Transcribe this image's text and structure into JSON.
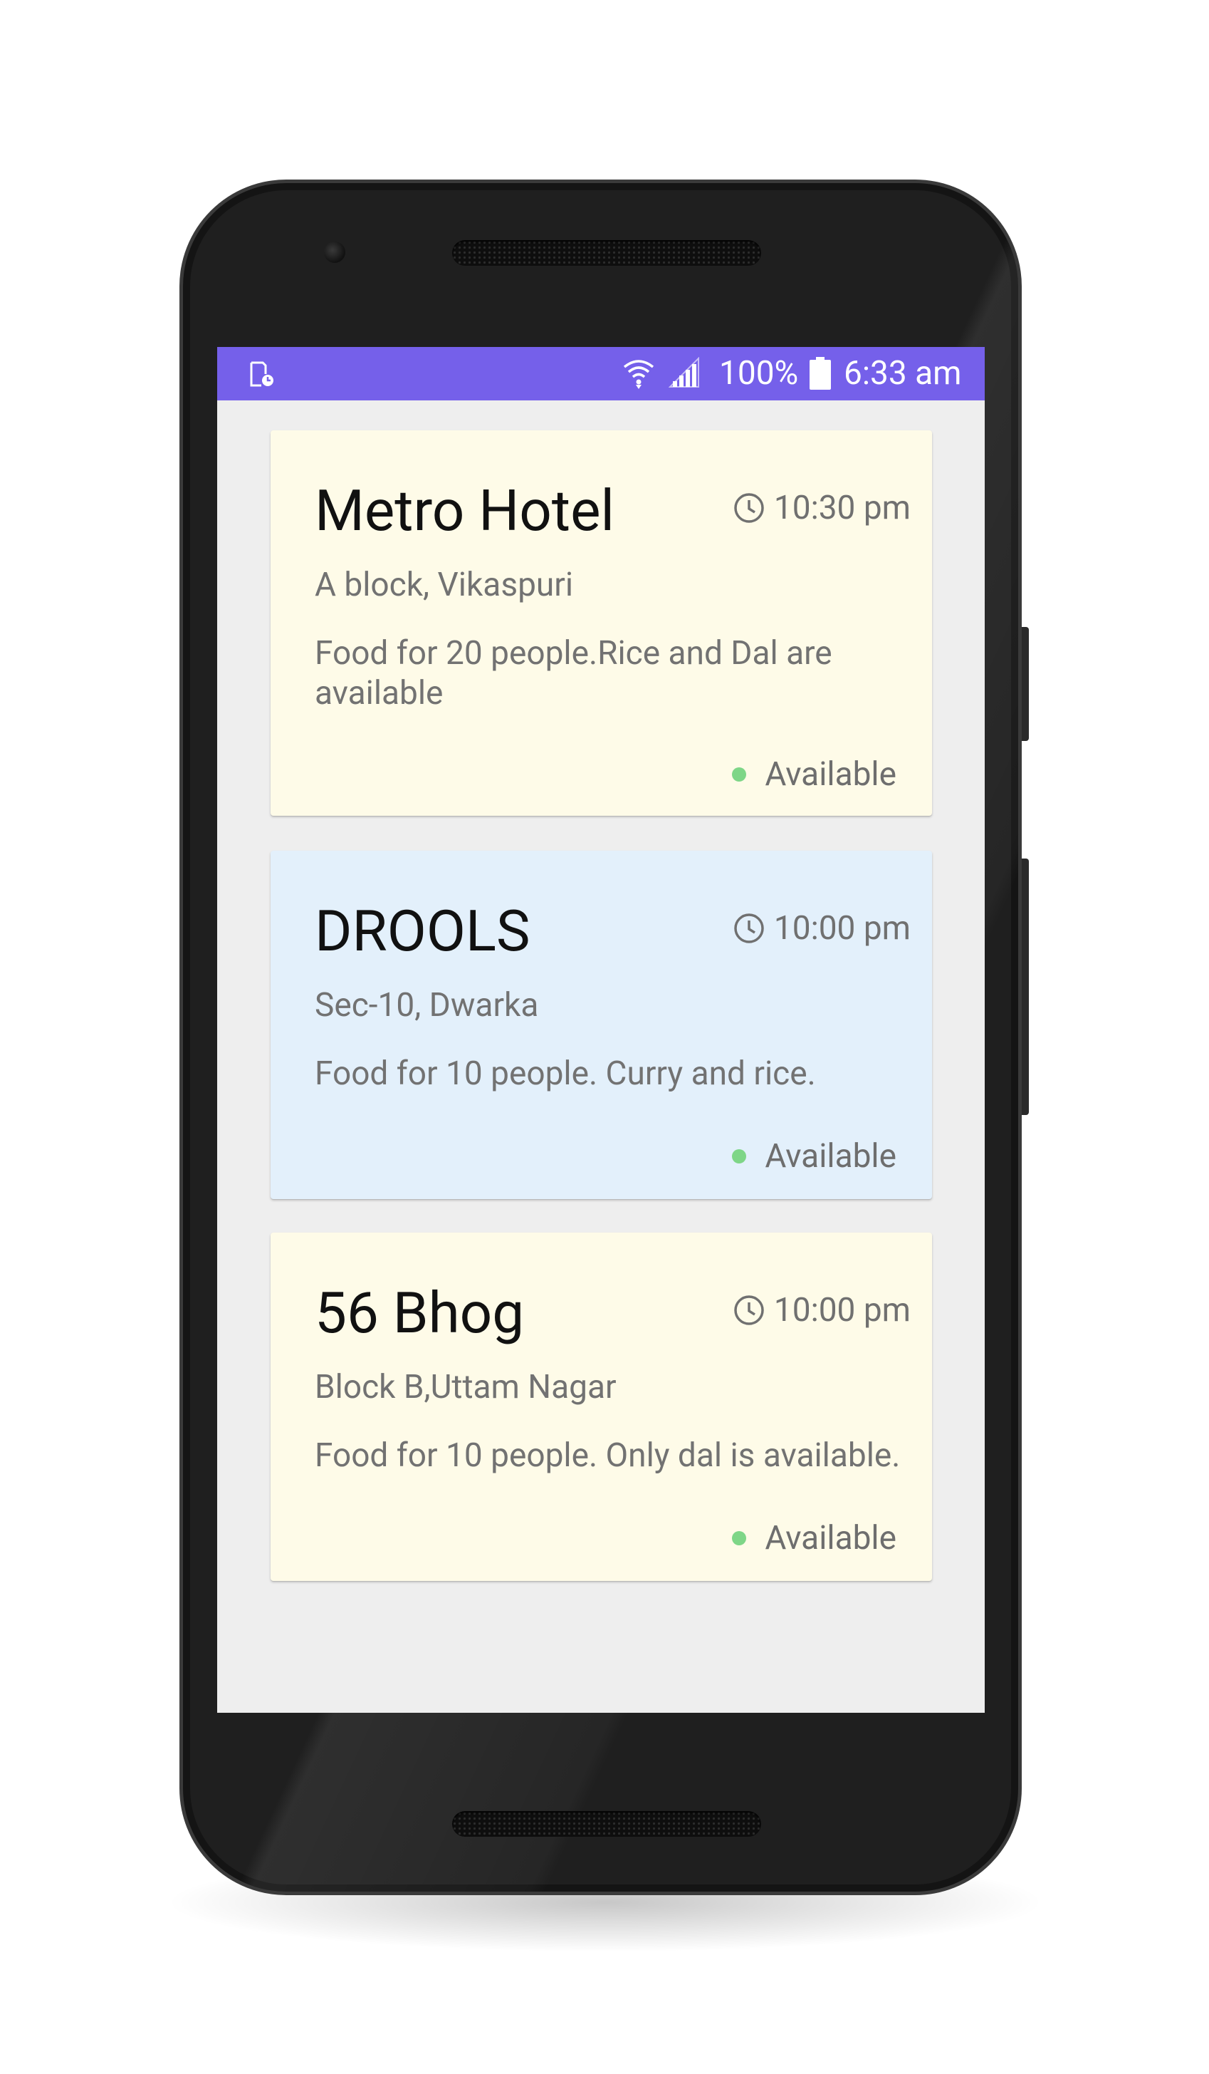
{
  "status_bar": {
    "battery_percent": "100%",
    "time": "6:33 am",
    "color": "#7560ea"
  },
  "cards": [
    {
      "name": "Metro Hotel",
      "time": "10:30 pm",
      "address": "A block, Vikaspuri",
      "description": "Food for 20 people.Rice and Dal are available",
      "status": "Available",
      "background": "#fefbe8",
      "status_color": "#7ed687"
    },
    {
      "name": "DROOLS",
      "time": "10:00 pm",
      "address": "Sec-10, Dwarka",
      "description": "Food for 10 people. Curry and rice.",
      "status": "Available",
      "background": "#e3f0fb",
      "status_color": "#7ed687"
    },
    {
      "name": "56 Bhog",
      "time": "10:00 pm",
      "address": "Block B,Uttam Nagar",
      "description": "Food for 10 people. Only dal is available.",
      "status": "Available",
      "background": "#fefbe8",
      "status_color": "#7ed687"
    }
  ],
  "icons": {
    "status_left": "sim-clock-icon",
    "wifi": "wifi-icon",
    "signal": "signal-icon",
    "battery": "battery-icon",
    "time": "clock-icon",
    "status_dot": "status-dot-icon"
  }
}
